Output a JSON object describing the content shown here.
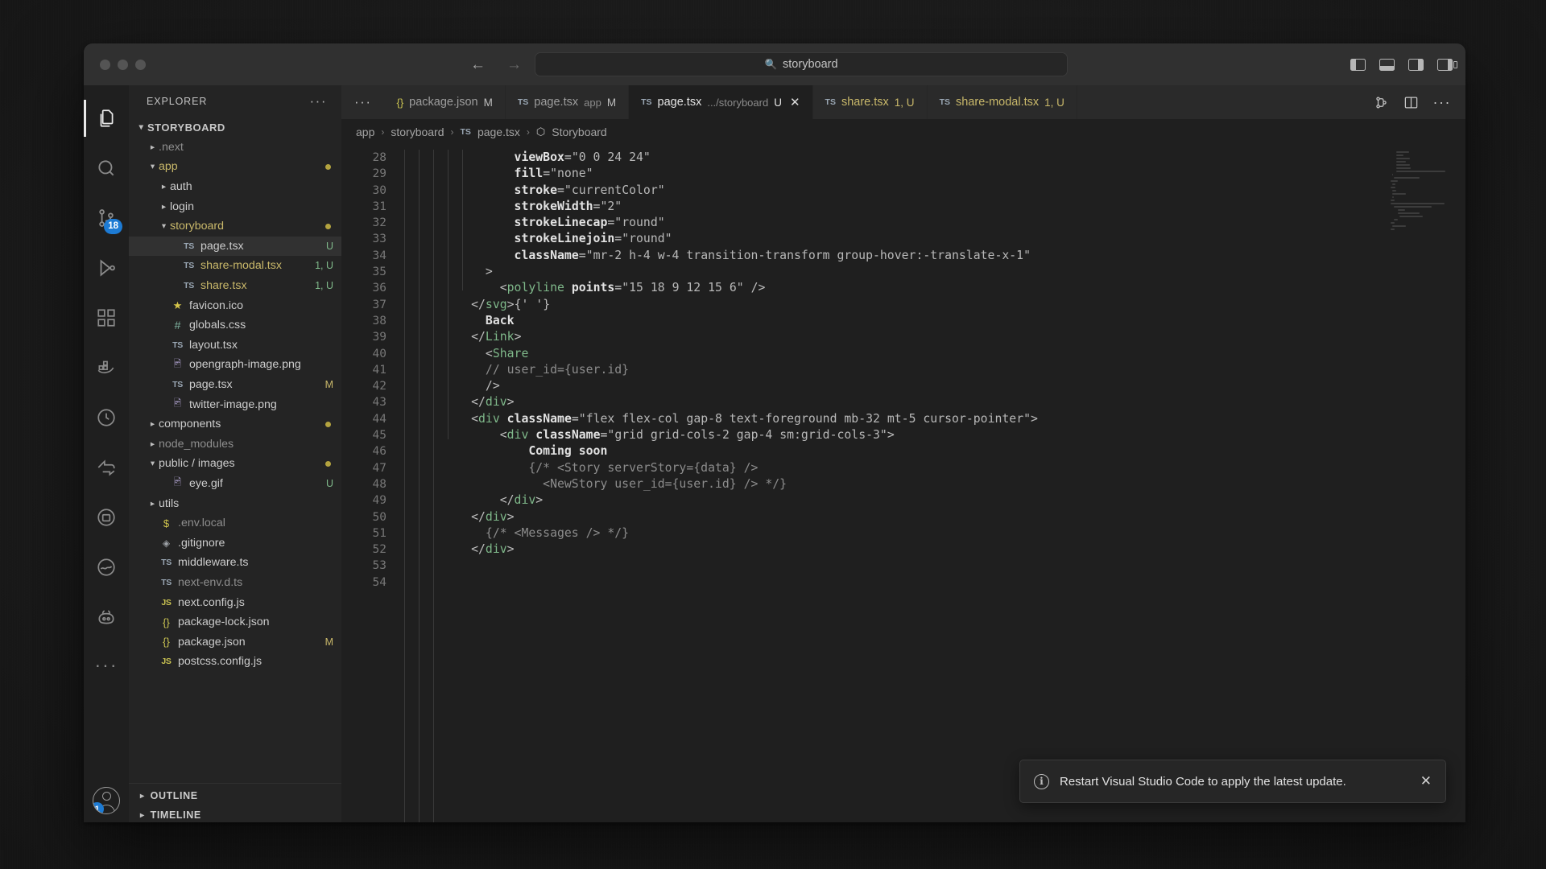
{
  "window": {
    "traffic_lights": [
      "close",
      "minimize",
      "maximize"
    ],
    "command_center": {
      "text": "storyboard",
      "icon": "search-icon"
    },
    "nav": {
      "back": "←",
      "forward": "→"
    }
  },
  "activitybar": {
    "items": [
      {
        "name": "explorer",
        "icon": "files-icon",
        "badge": ""
      },
      {
        "name": "search",
        "icon": "search-icon",
        "badge": ""
      },
      {
        "name": "source-control",
        "icon": "source-control-icon",
        "badge": "18"
      },
      {
        "name": "run-and-debug",
        "icon": "debug-icon",
        "badge": ""
      },
      {
        "name": "extensions",
        "icon": "extensions-icon",
        "badge": ""
      },
      {
        "name": "docker",
        "icon": "docker-icon",
        "badge": ""
      },
      {
        "name": "test",
        "icon": "beaker-icon",
        "badge": ""
      },
      {
        "name": "remote",
        "icon": "remote-icon",
        "badge": ""
      },
      {
        "name": "database",
        "icon": "database-icon",
        "badge": ""
      },
      {
        "name": "supabase",
        "icon": "supabase-icon",
        "badge": ""
      },
      {
        "name": "copilot",
        "icon": "copilot-icon",
        "badge": ""
      },
      {
        "name": "more",
        "icon": "ellipsis-icon",
        "badge": ""
      }
    ],
    "accounts": {
      "icon": "account-icon",
      "badge": "1"
    }
  },
  "sidebar": {
    "title": "EXPLORER",
    "more_actions": "···",
    "root": {
      "label": "STORYBOARD",
      "expanded": true
    },
    "tree": [
      {
        "label": ".next",
        "depth": 1,
        "type": "folder",
        "expanded": false,
        "style": "dim",
        "meta": "",
        "dot": false
      },
      {
        "label": "app",
        "depth": 1,
        "type": "folder",
        "expanded": true,
        "style": "yellow",
        "meta": "",
        "dot": true
      },
      {
        "label": "auth",
        "depth": 2,
        "type": "folder",
        "expanded": false,
        "style": "white",
        "meta": "",
        "dot": false
      },
      {
        "label": "login",
        "depth": 2,
        "type": "folder",
        "expanded": false,
        "style": "white",
        "meta": "",
        "dot": false
      },
      {
        "label": "storyboard",
        "depth": 2,
        "type": "folder",
        "expanded": true,
        "style": "yellow",
        "meta": "",
        "dot": true
      },
      {
        "label": "page.tsx",
        "depth": 3,
        "type": "ts",
        "style": "white",
        "meta": "U",
        "selected": true
      },
      {
        "label": "share-modal.tsx",
        "depth": 3,
        "type": "ts",
        "style": "yellow",
        "meta": "1, U"
      },
      {
        "label": "share.tsx",
        "depth": 3,
        "type": "ts",
        "style": "yellow",
        "meta": "1, U"
      },
      {
        "label": "favicon.ico",
        "depth": 2,
        "type": "star",
        "style": "white",
        "meta": ""
      },
      {
        "label": "globals.css",
        "depth": 2,
        "type": "css",
        "style": "white",
        "meta": ""
      },
      {
        "label": "layout.tsx",
        "depth": 2,
        "type": "ts",
        "style": "white",
        "meta": ""
      },
      {
        "label": "opengraph-image.png",
        "depth": 2,
        "type": "img",
        "style": "white",
        "meta": ""
      },
      {
        "label": "page.tsx",
        "depth": 2,
        "type": "ts",
        "style": "white",
        "meta": "M"
      },
      {
        "label": "twitter-image.png",
        "depth": 2,
        "type": "img",
        "style": "white",
        "meta": ""
      },
      {
        "label": "components",
        "depth": 1,
        "type": "folder",
        "expanded": false,
        "style": "white",
        "meta": "",
        "dot": true
      },
      {
        "label": "node_modules",
        "depth": 1,
        "type": "folder",
        "expanded": false,
        "style": "dim",
        "meta": ""
      },
      {
        "label": "public / images",
        "depth": 1,
        "type": "folder",
        "expanded": true,
        "style": "white",
        "meta": "",
        "dot": true
      },
      {
        "label": "eye.gif",
        "depth": 2,
        "type": "img",
        "style": "white",
        "meta": "U"
      },
      {
        "label": "utils",
        "depth": 1,
        "type": "folder",
        "expanded": false,
        "style": "white",
        "meta": ""
      },
      {
        "label": ".env.local",
        "depth": 1,
        "type": "env",
        "style": "dim",
        "meta": ""
      },
      {
        "label": ".gitignore",
        "depth": 1,
        "type": "git",
        "style": "white",
        "meta": ""
      },
      {
        "label": "middleware.ts",
        "depth": 1,
        "type": "ts",
        "style": "white",
        "meta": ""
      },
      {
        "label": "next-env.d.ts",
        "depth": 1,
        "type": "ts",
        "style": "dim",
        "meta": ""
      },
      {
        "label": "next.config.js",
        "depth": 1,
        "type": "js",
        "style": "white",
        "meta": ""
      },
      {
        "label": "package-lock.json",
        "depth": 1,
        "type": "json",
        "style": "white",
        "meta": ""
      },
      {
        "label": "package.json",
        "depth": 1,
        "type": "json",
        "style": "white",
        "meta": "M"
      },
      {
        "label": "postcss.config.js",
        "depth": 1,
        "type": "js",
        "style": "white",
        "meta": ""
      }
    ],
    "sections": [
      {
        "label": "OUTLINE",
        "expanded": false
      },
      {
        "label": "TIMELINE",
        "expanded": false
      }
    ]
  },
  "editor": {
    "tabs": [
      {
        "icon": "json-icon",
        "name": "package.json",
        "path": "",
        "status": "M",
        "active": false,
        "closable": false
      },
      {
        "icon": "ts-icon",
        "name": "page.tsx",
        "path": "app",
        "status": "M",
        "active": false,
        "closable": false
      },
      {
        "icon": "ts-icon",
        "name": "page.tsx",
        "path": ".../storyboard",
        "status": "U",
        "active": true,
        "closable": true
      },
      {
        "icon": "ts-icon",
        "name": "share.tsx",
        "path": "",
        "status": "1, U",
        "active": false,
        "closable": false
      },
      {
        "icon": "ts-icon",
        "name": "share-modal.tsx",
        "path": "",
        "status": "1, U",
        "active": false,
        "closable": false
      }
    ],
    "tab_actions": [
      "split-editor-icon",
      "more-actions-icon"
    ],
    "breadcrumb": [
      {
        "label": "app",
        "icon": ""
      },
      {
        "label": "storyboard",
        "icon": ""
      },
      {
        "label": "page.tsx",
        "icon": "ts-icon"
      },
      {
        "label": "Storyboard",
        "icon": "symbol-cube-icon"
      }
    ],
    "first_line": 28,
    "lines": [
      {
        "n": 28,
        "indent": 8,
        "tokens": [
          {
            "t": "attr",
            "v": "viewBox"
          },
          {
            "t": "kw",
            "v": "="
          },
          {
            "t": "str",
            "v": "\"0 0 24 24\""
          }
        ]
      },
      {
        "n": 29,
        "indent": 8,
        "tokens": [
          {
            "t": "attr",
            "v": "fill"
          },
          {
            "t": "kw",
            "v": "="
          },
          {
            "t": "str",
            "v": "\"none\""
          }
        ]
      },
      {
        "n": 30,
        "indent": 8,
        "tokens": [
          {
            "t": "attr",
            "v": "stroke"
          },
          {
            "t": "kw",
            "v": "="
          },
          {
            "t": "str",
            "v": "\"currentColor\""
          }
        ]
      },
      {
        "n": 31,
        "indent": 8,
        "tokens": [
          {
            "t": "attr",
            "v": "strokeWidth"
          },
          {
            "t": "kw",
            "v": "="
          },
          {
            "t": "str",
            "v": "\"2\""
          }
        ]
      },
      {
        "n": 32,
        "indent": 8,
        "tokens": [
          {
            "t": "attr",
            "v": "strokeLinecap"
          },
          {
            "t": "kw",
            "v": "="
          },
          {
            "t": "str",
            "v": "\"round\""
          }
        ]
      },
      {
        "n": 33,
        "indent": 8,
        "tokens": [
          {
            "t": "attr",
            "v": "strokeLinejoin"
          },
          {
            "t": "kw",
            "v": "="
          },
          {
            "t": "str",
            "v": "\"round\""
          }
        ]
      },
      {
        "n": 34,
        "indent": 8,
        "tokens": [
          {
            "t": "attr",
            "v": "className"
          },
          {
            "t": "kw",
            "v": "="
          },
          {
            "t": "str",
            "v": "\"mr-2 h-4 w-4 transition-transform group-hover:-translate-x-1\""
          }
        ]
      },
      {
        "n": 35,
        "indent": 6,
        "tokens": [
          {
            "t": "punc",
            "v": ">"
          }
        ]
      },
      {
        "n": 36,
        "indent": 7,
        "tokens": [
          {
            "t": "punc",
            "v": "<"
          },
          {
            "t": "tag",
            "v": "polyline"
          },
          {
            "t": "kw",
            "v": " "
          },
          {
            "t": "attr",
            "v": "points"
          },
          {
            "t": "kw",
            "v": "="
          },
          {
            "t": "str",
            "v": "\"15 18 9 12 15 6\""
          },
          {
            "t": "punc",
            "v": " />"
          }
        ]
      },
      {
        "n": 37,
        "indent": 5,
        "tokens": [
          {
            "t": "punc",
            "v": "</"
          },
          {
            "t": "tag",
            "v": "svg"
          },
          {
            "t": "punc",
            "v": ">{' '}"
          }
        ]
      },
      {
        "n": 38,
        "indent": 6,
        "tokens": [
          {
            "t": "txt",
            "v": "Back"
          }
        ]
      },
      {
        "n": 39,
        "indent": 5,
        "tokens": [
          {
            "t": "punc",
            "v": "</"
          },
          {
            "t": "tag",
            "v": "Link"
          },
          {
            "t": "punc",
            "v": ">"
          }
        ]
      },
      {
        "n": 40,
        "indent": 6,
        "tokens": [
          {
            "t": "punc",
            "v": "<"
          },
          {
            "t": "tag",
            "v": "Share"
          }
        ]
      },
      {
        "n": 41,
        "indent": 6,
        "tokens": [
          {
            "t": "cmt",
            "v": "// user_id={user.id}"
          }
        ]
      },
      {
        "n": 42,
        "indent": 6,
        "tokens": [
          {
            "t": "punc",
            "v": "/>"
          }
        ]
      },
      {
        "n": 43,
        "indent": 5,
        "tokens": [
          {
            "t": "punc",
            "v": "</"
          },
          {
            "t": "tag",
            "v": "div"
          },
          {
            "t": "punc",
            "v": ">"
          }
        ]
      },
      {
        "n": 44,
        "indent": 5,
        "tokens": [
          {
            "t": "punc",
            "v": "<"
          },
          {
            "t": "tag",
            "v": "div"
          },
          {
            "t": "kw",
            "v": " "
          },
          {
            "t": "attr",
            "v": "className"
          },
          {
            "t": "kw",
            "v": "="
          },
          {
            "t": "str",
            "v": "\"flex flex-col gap-8 text-foreground mb-32 mt-5 cursor-pointer\""
          },
          {
            "t": "punc",
            "v": ">"
          }
        ]
      },
      {
        "n": 45,
        "indent": 7,
        "tokens": [
          {
            "t": "punc",
            "v": "<"
          },
          {
            "t": "tag",
            "v": "div"
          },
          {
            "t": "kw",
            "v": " "
          },
          {
            "t": "attr",
            "v": "className"
          },
          {
            "t": "kw",
            "v": "="
          },
          {
            "t": "str",
            "v": "\"grid grid-cols-2 gap-4 sm:grid-cols-3\""
          },
          {
            "t": "punc",
            "v": ">"
          }
        ]
      },
      {
        "n": 46,
        "indent": 9,
        "tokens": [
          {
            "t": "txt",
            "v": "Coming soon"
          }
        ]
      },
      {
        "n": 47,
        "indent": 9,
        "tokens": [
          {
            "t": "cmt",
            "v": "{/* <Story serverStory={data} />"
          }
        ]
      },
      {
        "n": 48,
        "indent": 10,
        "tokens": [
          {
            "t": "cmt",
            "v": "<NewStory user_id={user.id} /> */}"
          }
        ],
        "bulb": true
      },
      {
        "n": 49,
        "indent": 7,
        "tokens": [
          {
            "t": "punc",
            "v": "</"
          },
          {
            "t": "tag",
            "v": "div"
          },
          {
            "t": "punc",
            "v": ">"
          }
        ]
      },
      {
        "n": 50,
        "indent": 5,
        "tokens": [
          {
            "t": "punc",
            "v": "</"
          },
          {
            "t": "tag",
            "v": "div"
          },
          {
            "t": "punc",
            "v": ">"
          }
        ]
      },
      {
        "n": 51,
        "indent": 6,
        "tokens": [
          {
            "t": "cmt",
            "v": "{/* <Messages /> */}"
          }
        ]
      },
      {
        "n": 52,
        "indent": 5,
        "tokens": [
          {
            "t": "punc",
            "v": "</"
          },
          {
            "t": "tag",
            "v": "div"
          },
          {
            "t": "punc",
            "v": ">"
          }
        ]
      },
      {
        "n": 53,
        "indent": 0,
        "tokens": []
      },
      {
        "n": 54,
        "indent": 0,
        "tokens": []
      }
    ]
  },
  "notification": {
    "icon": "info-icon",
    "message": "Restart Visual Studio Code to apply the latest update.",
    "close": "✕"
  },
  "colors": {
    "accent": "#1d7bd4",
    "modified": "#c9b86a",
    "untracked": "#7fb88a",
    "editor_bg": "#1f1f1f",
    "sidebar_bg": "#242424",
    "titlebar_bg": "#303030"
  }
}
